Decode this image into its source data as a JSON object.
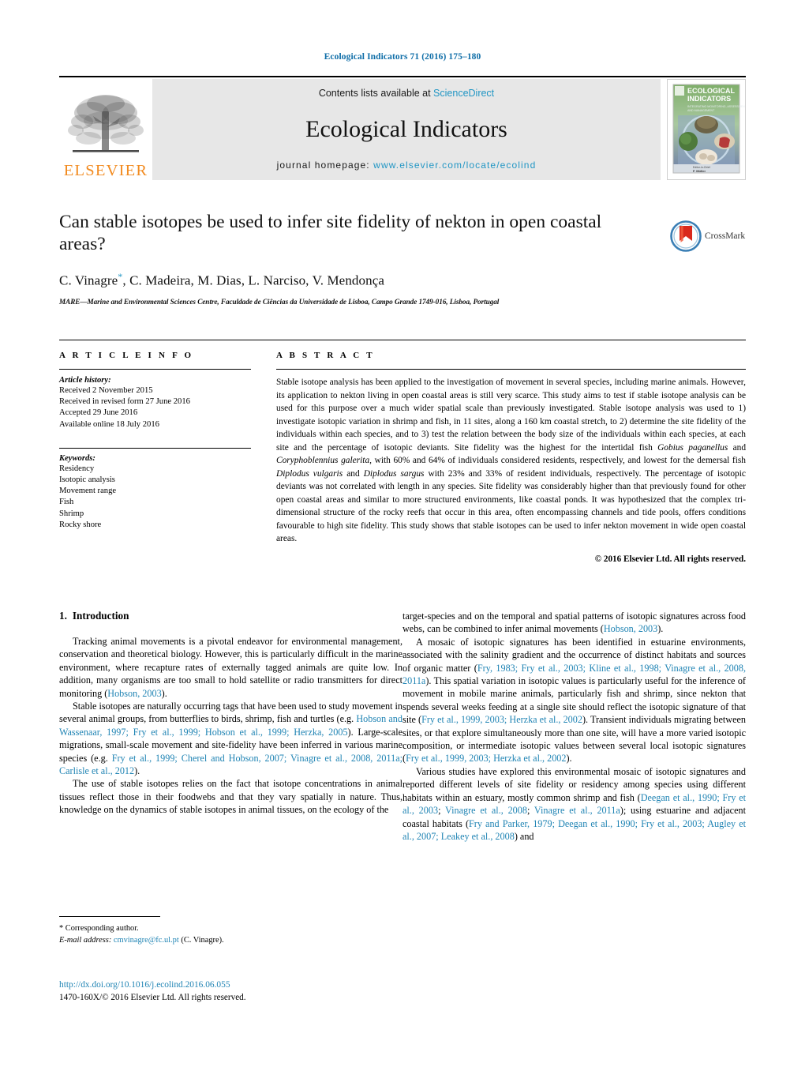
{
  "running_head": "Ecological Indicators 71 (2016) 175–180",
  "masthead": {
    "contents_prefix": "Contents lists available at ",
    "sciencedirect": "ScienceDirect",
    "journal_title": "Ecological Indicators",
    "homepage_label": "journal homepage: ",
    "homepage_url": "www.elsevier.com/locate/ecolind",
    "publisher_word": "ELSEVIER",
    "cover": {
      "line1": "ECOLOGICAL",
      "line2": "INDICATORS",
      "subtitle": "INTEGRATING MONITORING, ASSESSMENT AND MANAGEMENT",
      "footer1": "Editor-in-Chief",
      "footer2": "F. Müller"
    }
  },
  "article": {
    "title": "Can stable isotopes be used to infer site fidelity of nekton in open coastal areas?",
    "authors": "C. Vinagre, C. Madeira, M. Dias, L. Narciso, V. Mendonça",
    "corresponding_marker": "*",
    "affiliation": "MARE—Marine and Environmental Sciences Centre, Faculdade de Ciências da Universidade de Lisboa, Campo Grande 1749-016, Lisboa, Portugal",
    "crossmark_label": "CrossMark"
  },
  "info": {
    "heading": "A R T I C L E   I N F O",
    "history_label": "Article history:",
    "history": [
      "Received 2 November 2015",
      "Received in revised form 27 June 2016",
      "Accepted 29 June 2016",
      "Available online 18 July 2016"
    ],
    "keywords_label": "Keywords:",
    "keywords": [
      "Residency",
      "Isotopic analysis",
      "Movement range",
      "Fish",
      "Shrimp",
      "Rocky shore"
    ]
  },
  "abstract": {
    "heading": "A B S T R A C T",
    "text_part1": "Stable isotope analysis has been applied to the investigation of movement in several species, including marine animals. However, its application to nekton living in open coastal areas is still very scarce. This study aims to test if stable isotope analysis can be used for this purpose over a much wider spatial scale than previously investigated. Stable isotope analysis was used to 1) investigate isotopic variation in shrimp and fish, in 11 sites, along a 160 km coastal stretch, to 2) determine the site fidelity of the individuals within each species, and to 3) test the relation between the body size of the individuals within each species, at each site and the percentage of isotopic deviants. Site fidelity was the highest for the intertidal fish ",
    "italic1": "Gobius paganellus",
    "text_part2": " and ",
    "italic2": "Coryphoblennius galerita",
    "text_part3": ", with 60% and 64% of individuals considered residents, respectively, and lowest for the demersal fish ",
    "italic3": "Diplodus vulgaris",
    "text_part4": " and ",
    "italic4": "Diplodus sargus",
    "text_part5": " with 23% and 33% of resident individuals, respectively. The percentage of isotopic deviants was not correlated with length in any species. Site fidelity was considerably higher than that previously found for other open coastal areas and similar to more structured environments, like coastal ponds. It was hypothesized that the complex tri-dimensional structure of the rocky reefs that occur in this area, often encompassing channels and tide pools, offers conditions favourable to high site fidelity. This study shows that stable isotopes can be used to infer nekton movement in wide open coastal areas.",
    "copyright": "© 2016 Elsevier Ltd. All rights reserved."
  },
  "body": {
    "section_number": "1.",
    "section_title": "Introduction",
    "col1": [
      {
        "runs": [
          {
            "t": "Tracking animal movements is a pivotal endeavor for environmental management, conservation and theoretical biology. However, this is particularly difficult in the marine environment, where recapture rates of externally tagged animals are quite low. In addition, many organisms are too small to hold satellite or radio transmitters for direct monitoring (",
            "c": false
          },
          {
            "t": "Hobson, 2003",
            "c": true
          },
          {
            "t": ").",
            "c": false
          }
        ]
      },
      {
        "runs": [
          {
            "t": "Stable isotopes are naturally occurring tags that have been used to study movement in several animal groups, from butterflies to birds, shrimp, fish and turtles (e.g. ",
            "c": false
          },
          {
            "t": "Hobson and Wassenaar, 1997; Fry et al., 1999; Hobson et al., 1999; Herzka, 2005",
            "c": true
          },
          {
            "t": "). Large-scale migrations, small-scale movement and site-fidelity have been inferred in various marine species (e.g. ",
            "c": false
          },
          {
            "t": "Fry et al., 1999; Cherel and Hobson, 2007; Vinagre et al., 2008, 2011a; Carlisle et al., 2012",
            "c": true
          },
          {
            "t": ").",
            "c": false
          }
        ]
      },
      {
        "runs": [
          {
            "t": "The use of stable isotopes relies on the fact that isotope concentrations in animal tissues reflect those in their foodwebs and that they vary spatially in nature. Thus, knowledge on the dynamics of stable isotopes in animal tissues, on the ecology of the",
            "c": false
          }
        ]
      }
    ],
    "col2": [
      {
        "runs": [
          {
            "t": "target-species and on the temporal and spatial patterns of isotopic signatures across food webs, can be combined to infer animal movements (",
            "c": false
          },
          {
            "t": "Hobson, 2003",
            "c": true
          },
          {
            "t": ").",
            "c": false
          }
        ],
        "noindent": true
      },
      {
        "runs": [
          {
            "t": "A mosaic of isotopic signatures has been identified in estuarine environments, associated with the salinity gradient and the occurrence of distinct habitats and sources of organic matter (",
            "c": false
          },
          {
            "t": "Fry, 1983; Fry et al., 2003; Kline et al., 1998; Vinagre et al., 2008, 2011a",
            "c": true
          },
          {
            "t": "). This spatial variation in isotopic values is particularly useful for the inference of movement in mobile marine animals, particularly fish and shrimp, since nekton that spends several weeks feeding at a single site should reflect the isotopic signature of that site (",
            "c": false
          },
          {
            "t": "Fry et al., 1999, 2003; Herzka et al., 2002",
            "c": true
          },
          {
            "t": "). Transient individuals migrating between sites, or that explore simultaneously more than one site, will have a more varied isotopic composition, or intermediate isotopic values between several local isotopic signatures (",
            "c": false
          },
          {
            "t": "Fry et al., 1999, 2003; Herzka et al., 2002",
            "c": true
          },
          {
            "t": ").",
            "c": false
          }
        ]
      },
      {
        "runs": [
          {
            "t": "Various studies have explored this environmental mosaic of isotopic signatures and reported different levels of site fidelity or residency among species using different habitats within an estuary, mostly common shrimp and fish (",
            "c": false
          },
          {
            "t": "Deegan et al., 1990; Fry et al., 2003",
            "c": true
          },
          {
            "t": "; ",
            "c": false
          },
          {
            "t": "Vinagre et al., 2008",
            "c": true
          },
          {
            "t": "; ",
            "c": false
          },
          {
            "t": "Vinagre et al., 2011a",
            "c": true
          },
          {
            "t": "); using estuarine and adjacent coastal habitats (",
            "c": false
          },
          {
            "t": "Fry and Parker, 1979; Deegan et al., 1990; Fry et al., 2003; Augley et al., 2007; Leakey et al., 2008",
            "c": true
          },
          {
            "t": ") and",
            "c": false
          }
        ]
      }
    ]
  },
  "footnote": {
    "corresponding": "* Corresponding author.",
    "email_label": "E-mail address:",
    "email": "cmvinagre@fc.ul.pt",
    "email_suffix": "(C. Vinagre)."
  },
  "page_footer": {
    "doi": "http://dx.doi.org/10.1016/j.ecolind.2016.06.055",
    "issn": "1470-160X/© 2016 Elsevier Ltd. All rights reserved."
  },
  "colors": {
    "link_blue": "#2084b4",
    "header_blue": "#0f6ea8",
    "elsevier_orange": "#F28B20",
    "masthead_gray": "#e7e7e7"
  }
}
